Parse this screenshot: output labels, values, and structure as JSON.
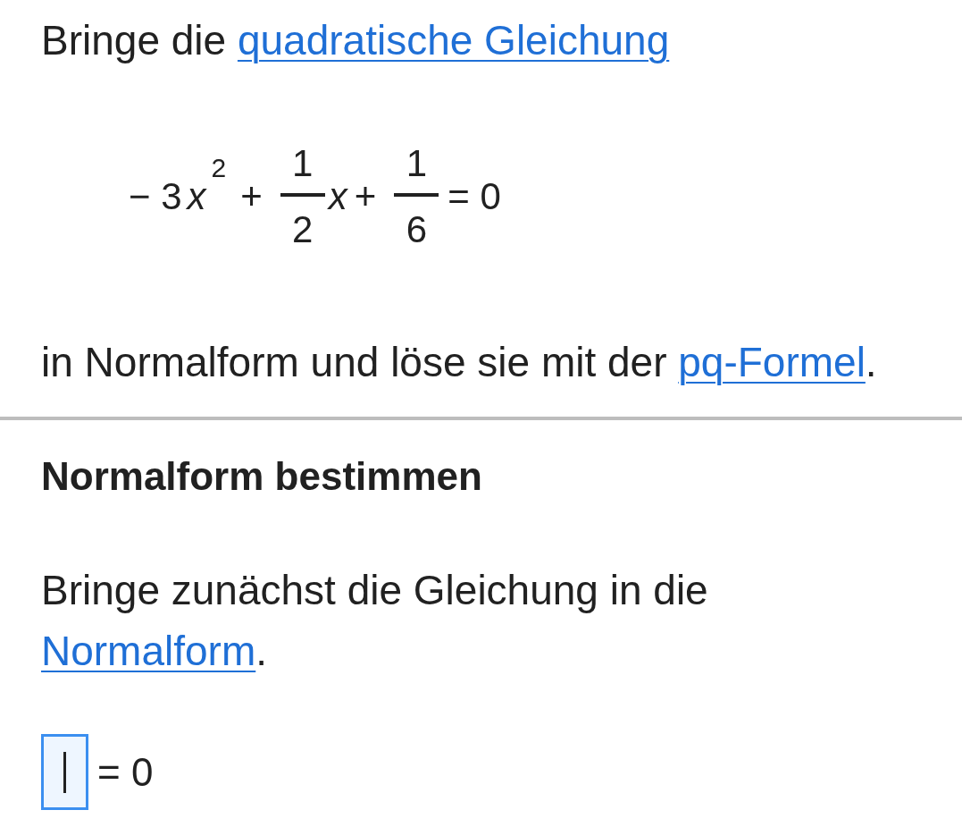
{
  "task": {
    "intro": [
      {
        "kind": "text",
        "text": "Bringe die "
      },
      {
        "kind": "link",
        "text": "quadratische Gleichung"
      }
    ],
    "equation": [
      {
        "kind": "text",
        "text": "− 3"
      },
      {
        "kind": "var",
        "text": "x",
        "sup": "2"
      },
      {
        "kind": "text",
        "text": "+"
      },
      {
        "kind": "fraction",
        "num": "1",
        "den": "2"
      },
      {
        "kind": "var",
        "text": "x"
      },
      {
        "kind": "text",
        "text": "+"
      },
      {
        "kind": "fraction",
        "num": "1",
        "den": "6"
      },
      {
        "kind": "text",
        "text": "= 0"
      }
    ],
    "outro": [
      {
        "kind": "text",
        "text": "in Normalform und löse sie mit der "
      },
      {
        "kind": "link",
        "text": "pq-Formel"
      },
      {
        "kind": "text",
        "text": "."
      }
    ]
  },
  "step": {
    "heading": "Normalform bestimmen",
    "text": [
      {
        "kind": "text",
        "text": "Bringe zunächst die Gleichung in die "
      },
      {
        "kind": "link",
        "text": "Normalform"
      },
      {
        "kind": "text",
        "text": "."
      }
    ],
    "answer": {
      "focused": true,
      "rhs": "= 0"
    }
  }
}
